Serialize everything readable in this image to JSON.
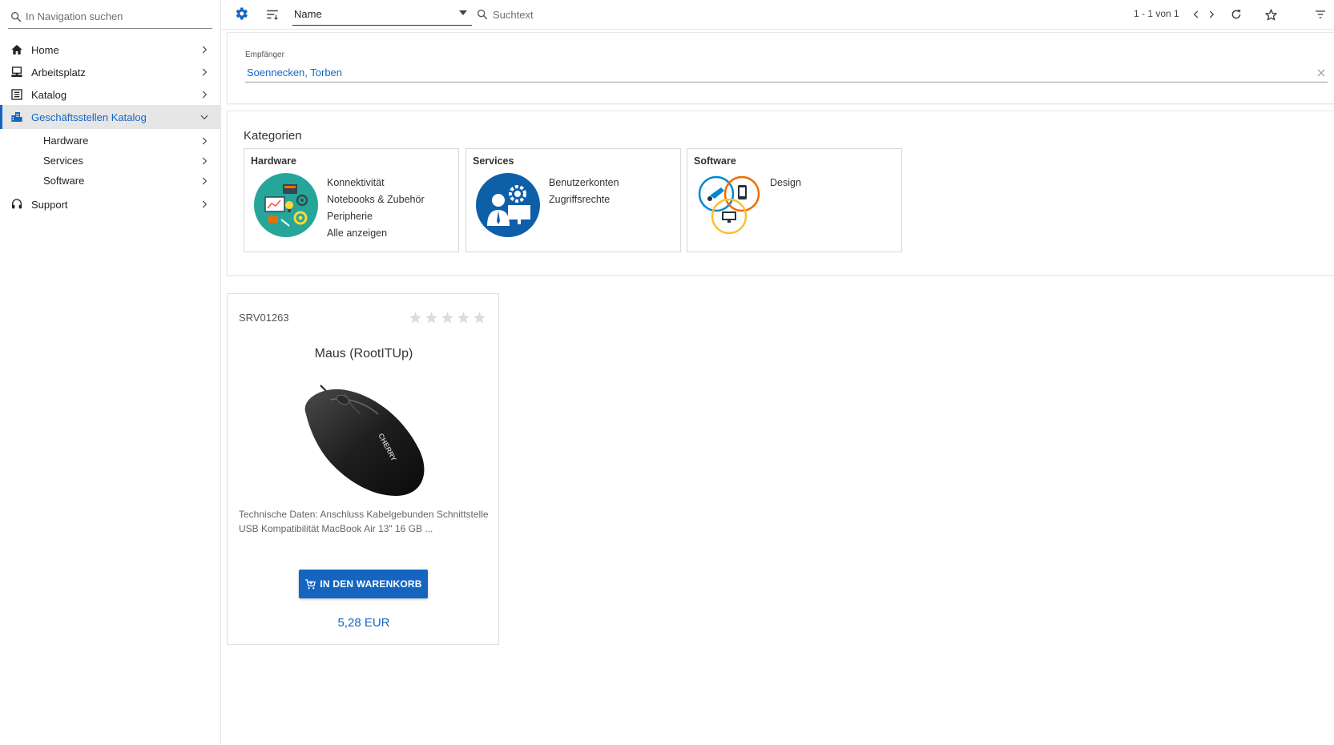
{
  "sidebar": {
    "search_placeholder": "In Navigation suchen",
    "items": [
      {
        "label": "Home",
        "icon": "home-icon"
      },
      {
        "label": "Arbeitsplatz",
        "icon": "workstation-icon"
      },
      {
        "label": "Katalog",
        "icon": "catalog-list-icon"
      },
      {
        "label": "Geschäftsstellen Katalog",
        "icon": "building-icon",
        "active": true
      },
      {
        "label": "Support",
        "icon": "headset-icon"
      }
    ],
    "subitems": [
      {
        "label": "Hardware"
      },
      {
        "label": "Services"
      },
      {
        "label": "Software"
      }
    ]
  },
  "toolbar": {
    "sort_field": "Name",
    "search_placeholder": "Suchtext",
    "result_count": "1 - 1 von 1"
  },
  "recipient": {
    "label": "Empfänger",
    "value": "Soennecken, Torben"
  },
  "categories": {
    "title": "Kategorien",
    "boxes": [
      {
        "title": "Hardware",
        "links": [
          "Konnektivität",
          "Notebooks & Zubehör",
          "Peripherie",
          "Alle anzeigen"
        ]
      },
      {
        "title": "Services",
        "links": [
          "Benutzerkonten",
          "Zugriffsrechte"
        ]
      },
      {
        "title": "Software",
        "links": [
          "Design"
        ]
      }
    ]
  },
  "product": {
    "id": "SRV01263",
    "rating": 0,
    "rating_max": 5,
    "name": "Maus (RootITUp)",
    "description": "Technische Daten: Anschluss Kabelgebunden Schnittstelle USB Kompatibilität MacBook Air 13\" 16 GB ...",
    "cart_button": "IN DEN WARENKORB",
    "price": "5,28 EUR",
    "brand_on_image": "CHERRY"
  },
  "colors": {
    "accent": "#1565c0",
    "active_bg": "#e6e6e6",
    "hardware_circle": "#26a69a",
    "services_circle": "#0d5fa8"
  }
}
